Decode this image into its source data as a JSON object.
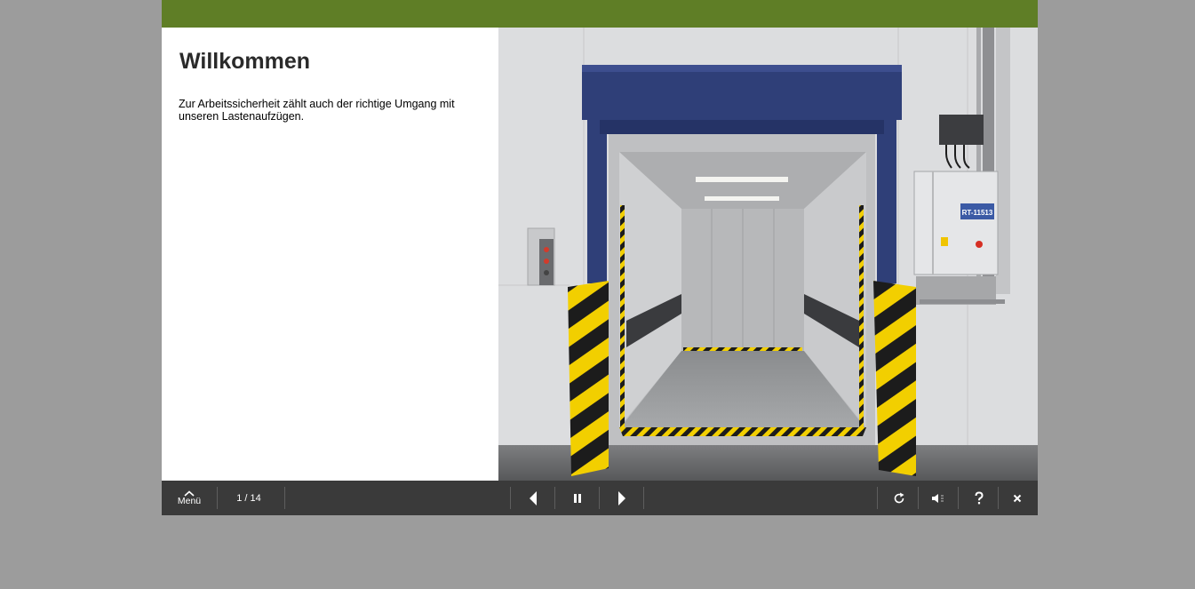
{
  "slide": {
    "title": "Willkommen",
    "text": "Zur Arbeitssicherheit zählt auch der richtige Umgang mit unseren Lastenaufzügen."
  },
  "image": {
    "panel_label": "RT-11513"
  },
  "controls": {
    "menu_label": "Menü",
    "page_current": "1",
    "page_total": "14",
    "page_separator": " / ",
    "icons": [
      "chevron-up-icon",
      "previous-icon",
      "pause-icon",
      "next-icon",
      "replay-icon",
      "sound-icon",
      "help-icon",
      "close-icon"
    ]
  },
  "colors": {
    "top_bar": "#5f7e26",
    "control_bar": "#3a3a3a",
    "background": "#9c9c9c"
  }
}
